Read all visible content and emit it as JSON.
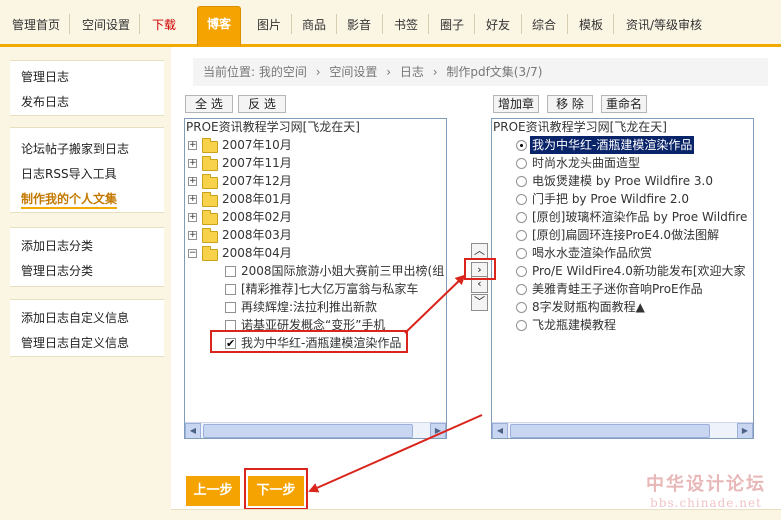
{
  "nav": {
    "tabs": [
      "管理首页",
      "空间设置",
      "下载",
      "博客",
      "图片",
      "商品",
      "影音",
      "书签",
      "圈子",
      "好友",
      "综合",
      "模板",
      "资讯/等级审核"
    ],
    "active": "博客",
    "accent_color": "#f5a300"
  },
  "sidebar": {
    "group1": [
      "管理日志",
      "发布日志"
    ],
    "group2": [
      "论坛帖子搬家到日志",
      "日志RSS导入工具",
      "制作我的个人文集"
    ],
    "group3": [
      "添加日志分类",
      "管理日志分类"
    ],
    "group4": [
      "添加日志自定义信息",
      "管理日志自定义信息"
    ],
    "current": "制作我的个人文集"
  },
  "breadcrumb": {
    "prefix": "当前位置:",
    "items": [
      "我的空间",
      "空间设置",
      "日志",
      "制作pdf文集(3/7)"
    ],
    "separator": "›"
  },
  "left_panel": {
    "buttons": {
      "select_all": "全 选",
      "invert": "反 选"
    },
    "root": "PROE资讯教程学习网[飞龙在天]",
    "folders": [
      "2007年10月",
      "2007年11月",
      "2007年12月",
      "2008年01月",
      "2008年02月",
      "2008年03月",
      "2008年04月"
    ],
    "items": [
      {
        "label": "2008国际旅游小姐大赛前三甲出榜(组",
        "checked": false
      },
      {
        "label": "[精彩推荐]七大亿万富翁与私家车",
        "checked": false
      },
      {
        "label": "再续辉煌:法拉利推出新款",
        "checked": false
      },
      {
        "label": "诺基亚研发概念“变形”手机",
        "checked": false
      },
      {
        "label": "我为中华红-酒瓶建模渲染作品",
        "checked": true
      }
    ]
  },
  "move_buttons": [
    "︿",
    "›",
    "‹",
    "﹀"
  ],
  "right_panel": {
    "buttons": {
      "add": "增加章",
      "remove": "移 除",
      "rename": "重命名"
    },
    "root": "PROE资讯教程学习网[飞龙在天]",
    "items": [
      {
        "label": "我为中华红-酒瓶建模渲染作品",
        "selected": true
      },
      {
        "label": "时尚水龙头曲面造型",
        "selected": false
      },
      {
        "label": "电饭煲建模 by Proe Wildfire 3.0",
        "selected": false
      },
      {
        "label": "门手把 by Proe Wildfire 2.0",
        "selected": false
      },
      {
        "label": "[原创]玻璃杯渲染作品 by Proe Wildfire",
        "selected": false
      },
      {
        "label": "[原创]扁圆环连接ProE4.0做法图解",
        "selected": false
      },
      {
        "label": "喝水水壶渲染作品欣赏",
        "selected": false
      },
      {
        "label": "Pro/E WildFire4.0新功能发布[欢迎大家",
        "selected": false
      },
      {
        "label": "美雅青蛙王子迷你音响ProE作品",
        "selected": false
      },
      {
        "label": "8字发财瓶构面教程▲",
        "selected": false
      },
      {
        "label": "飞龙瓶建模教程",
        "selected": false
      }
    ]
  },
  "actions": {
    "prev": "上一步",
    "next": "下一步"
  },
  "watermark": {
    "title": "中华设计论坛",
    "url": "bbs.chinade.net"
  }
}
